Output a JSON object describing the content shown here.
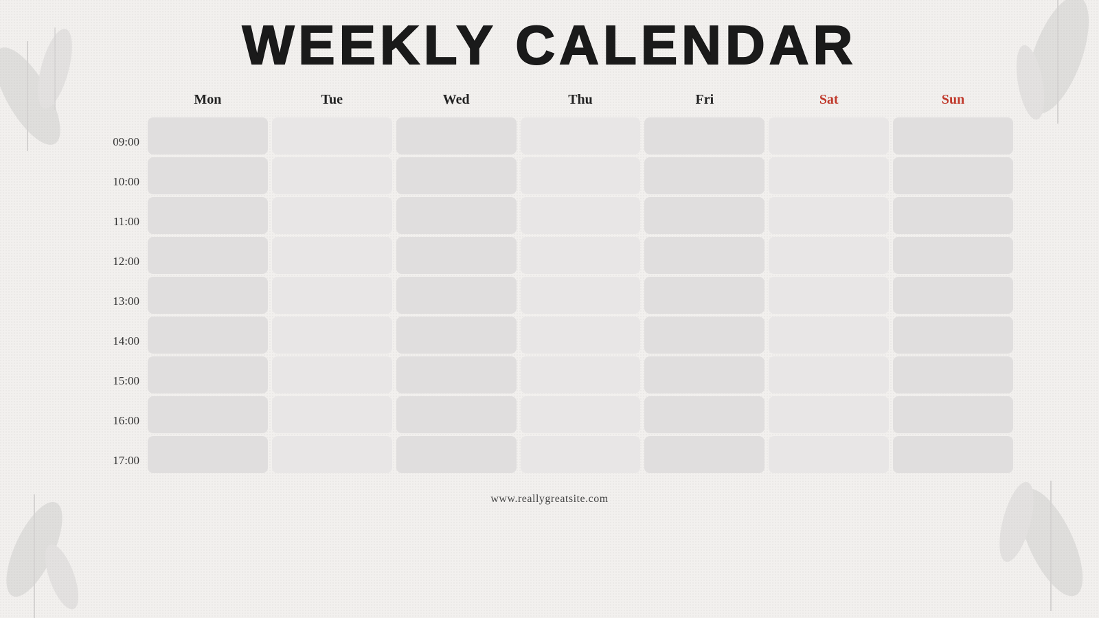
{
  "title": "WEEKLY CALENDAR",
  "days": [
    {
      "label": "Mon",
      "weekend": false
    },
    {
      "label": "Tue",
      "weekend": false
    },
    {
      "label": "Wed",
      "weekend": false
    },
    {
      "label": "Thu",
      "weekend": false
    },
    {
      "label": "Fri",
      "weekend": false
    },
    {
      "label": "Sat",
      "weekend": true
    },
    {
      "label": "Sun",
      "weekend": true
    }
  ],
  "times": [
    "09:00",
    "10:00",
    "11:00",
    "12:00",
    "13:00",
    "14:00",
    "15:00",
    "16:00",
    "17:00"
  ],
  "footer": {
    "url": "www.reallygreatsite.com"
  },
  "colors": {
    "weekend": "#c0392b",
    "weekday": "#222222",
    "slot": "#e0dede",
    "background": "#f2f0ee"
  }
}
